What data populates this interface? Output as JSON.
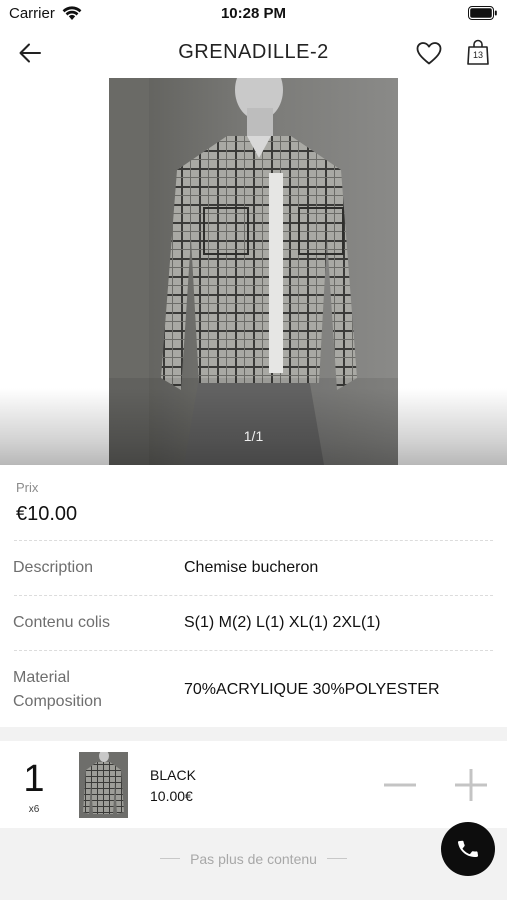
{
  "status_bar": {
    "carrier": "Carrier",
    "time": "10:28 PM"
  },
  "nav": {
    "title": "GRENADILLE-2",
    "cart_count": "13"
  },
  "gallery": {
    "counter": "1/1"
  },
  "price": {
    "label": "Prix",
    "value": "€10.00"
  },
  "specs": [
    {
      "label": "Description",
      "value": "Chemise bucheron"
    },
    {
      "label": "Contenu colis",
      "value": "S(1) M(2) L(1) XL(1) 2XL(1)"
    },
    {
      "label_line1": "Material",
      "label_line2": "Composition",
      "value": "70%ACRYLIQUE 30%POLYESTER"
    }
  ],
  "variant": {
    "quantity": "1",
    "multiplier": "x6",
    "color": "BLACK",
    "price": "10.00€"
  },
  "footer": {
    "text": "Pas plus de contenu"
  },
  "icons": {
    "back": "arrow-left-icon",
    "favorite": "heart-icon",
    "cart": "shopping-bag-icon",
    "decrease": "minus-icon",
    "increase": "plus-icon",
    "call": "phone-icon"
  },
  "colors": {
    "accent": "#0d0d0d",
    "muted_text": "#8c8c8c",
    "band": "#f2f2f2"
  }
}
